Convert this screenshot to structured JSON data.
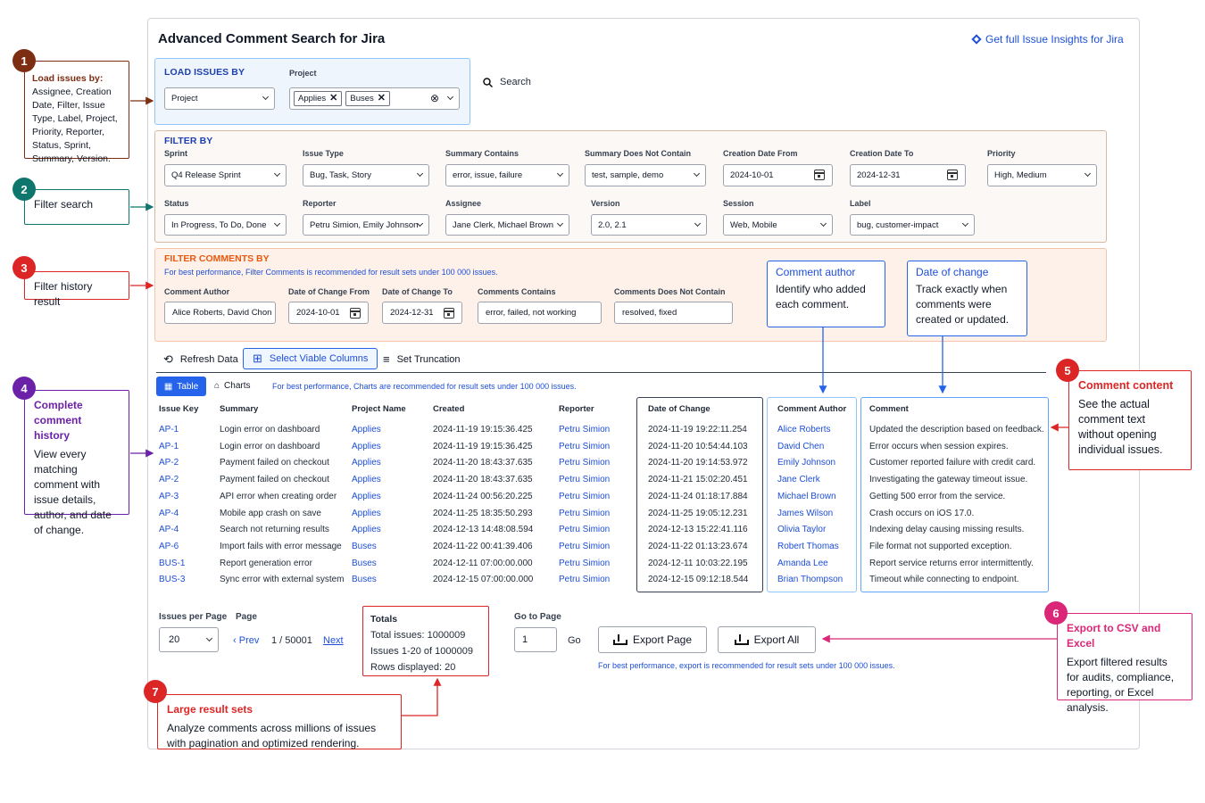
{
  "app": {
    "title": "Advanced Comment Search for Jira",
    "insights_link": "Get full Issue Insights for Jira"
  },
  "load": {
    "title": "LOAD ISSUES BY",
    "project_label": "Project",
    "select_value": "Project",
    "chips": [
      "Applies",
      "Buses"
    ],
    "search_label": "Search"
  },
  "filter": {
    "title": "FILTER BY",
    "fields": [
      {
        "label": "Sprint",
        "value": "Q4 Release Sprint"
      },
      {
        "label": "Issue Type",
        "value": "Bug, Task, Story"
      },
      {
        "label": "Summary Contains",
        "value": "error, issue, failure"
      },
      {
        "label": "Summary Does Not Contain",
        "value": "test, sample, demo"
      },
      {
        "label": "Creation Date From",
        "value": "2024-10-01"
      },
      {
        "label": "Creation Date To",
        "value": "2024-12-31"
      },
      {
        "label": "Priority",
        "value": "High, Medium"
      },
      {
        "label": "Status",
        "value": "In Progress, To Do, Done"
      },
      {
        "label": "Reporter",
        "value": "Petru Simion, Emily Johnson"
      },
      {
        "label": "Assignee",
        "value": "Jane Clerk, Michael Brown"
      },
      {
        "label": "Version",
        "value": "2.0, 2.1"
      },
      {
        "label": "Session",
        "value": "Web, Mobile"
      },
      {
        "label": "Label",
        "value": "bug, customer-impact"
      }
    ]
  },
  "filter_comments": {
    "title": "FILTER COMMENTS BY",
    "note": "For best performance, Filter Comments is recommended for result sets under 100 000 issues.",
    "fields": [
      {
        "label": "Comment Author",
        "value": "Alice Roberts, David Chon"
      },
      {
        "label": "Date of Change From",
        "value": "2024-10-01"
      },
      {
        "label": "Date of Change To",
        "value": "2024-12-31"
      },
      {
        "label": "Comments Contains",
        "value": "error, failed, not working"
      },
      {
        "label": "Comments Does Not Contain",
        "value": "resolved, fixed"
      }
    ]
  },
  "callouts": {
    "author": {
      "title": "Comment author",
      "text": "Identify who added each comment."
    },
    "date": {
      "title": "Date of change",
      "text": "Track exactly when comments were created or updated."
    }
  },
  "toolbar": {
    "refresh": "Refresh Data",
    "columns": "Select Viable Columns",
    "truncation": "Set Truncation",
    "tab_table": "Table",
    "tab_charts": "Charts",
    "charts_note": "For best performance, Charts are recommended for result sets under 100 000 issues."
  },
  "table": {
    "headers": [
      "Issue Key",
      "Summary",
      "Project Name",
      "Created",
      "Reporter",
      "Date of Change",
      "Comment Author",
      "Comment"
    ],
    "rows": [
      [
        "AP-1",
        "Login error on dashboard",
        "Applies",
        "2024-11-19 19:15:36.425",
        "Petru Simion",
        "2024-11-19 19:22:11.254",
        "Alice Roberts",
        "Updated the description based on feedback."
      ],
      [
        "AP-1",
        "Login error on dashboard",
        "Applies",
        "2024-11-19 19:15:36.425",
        "Petru Simion",
        "2024-11-20 10:54:44.103",
        "David Chen",
        "Error occurs when session expires."
      ],
      [
        "AP-2",
        "Payment failed on checkout",
        "Applies",
        "2024-11-20 18:43:37.635",
        "Petru Simion",
        "2024-11-20 19:14:53.972",
        "Emily Johnson",
        "Customer reported failure with credit card."
      ],
      [
        "AP-2",
        "Payment failed on checkout",
        "Applies",
        "2024-11-20 18:43:37.635",
        "Petru Simion",
        "2024-11-21 15:02:20.451",
        "Jane Clerk",
        "Investigating the gateway timeout issue."
      ],
      [
        "AP-3",
        "API error when creating order",
        "Applies",
        "2024-11-24 00:56:20.225",
        "Petru Simion",
        "2024-11-24 01:18:17.884",
        "Michael Brown",
        "Getting 500 error from the service."
      ],
      [
        "AP-4",
        "Mobile app crash on save",
        "Applies",
        "2024-11-25 18:35:50.293",
        "Petru Simion",
        "2024-11-25 19:05:12.231",
        "James Wilson",
        "Crash occurs on iOS 17.0."
      ],
      [
        "AP-4",
        "Search not returning results",
        "Applies",
        "2024-12-13 14:48:08.594",
        "Petru Simion",
        "2024-12-13 15:22:41.116",
        "Olivia Taylor",
        "Indexing delay causing missing results."
      ],
      [
        "AP-6",
        "Import fails with error message",
        "Buses",
        "2024-11-22 00:41:39.406",
        "Petru Simion",
        "2024-11-22 01:13:23.674",
        "Robert Thomas",
        "File format not supported exception."
      ],
      [
        "BUS-1",
        "Report generation error",
        "Buses",
        "2024-12-11 07:00:00.000",
        "Petru Simion",
        "2024-12-11 10:03:22.195",
        "Amanda Lee",
        "Report service returns error intermittently."
      ],
      [
        "BUS-3",
        "Sync error with external system",
        "Buses",
        "2024-12-15 07:00:00.000",
        "Petru Simion",
        "2024-12-15 09:12:18.544",
        "Brian Thompson",
        "Timeout while connecting to endpoint."
      ]
    ]
  },
  "pager": {
    "per_page_label": "Issues per Page",
    "per_page": "20",
    "page_label": "Page",
    "prev": "Prev",
    "page_value": "1 / 50001",
    "next": "Next",
    "totals_title": "Totals",
    "total_issues": "Total issues: 1000009",
    "issues_range": "Issues 1-20 of 1000009",
    "rows_displayed": "Rows displayed: 20",
    "goto_label": "Go to Page",
    "goto_value": "1",
    "go": "Go",
    "export_page": "Export Page",
    "export_all": "Export All",
    "export_note": "For best performance, export is recommended for result sets under 100 000 issues."
  },
  "annotations": [
    {
      "num": "1",
      "color": "#7c2d12",
      "title": "Load issues by:",
      "text": "Assignee, Creation Date, Filter, Issue Type, Label, Project, Priority, Reporter, Status, Sprint, Summary, Version."
    },
    {
      "num": "2",
      "color": "#0f766e",
      "title": "",
      "text": "Filter search"
    },
    {
      "num": "3",
      "color": "#dc2626",
      "title": "",
      "text": "Filter history result"
    },
    {
      "num": "4",
      "color": "#6b21a8",
      "title": "Complete comment history",
      "text": "View every matching comment with issue details, author, and date of change."
    },
    {
      "num": "5",
      "color": "#dc2626",
      "title": "Comment content",
      "text": "See the actual comment text without opening individual issues."
    },
    {
      "num": "6",
      "color": "#db2777",
      "title": "Export to CSV and Excel",
      "text": "Export filtered results for audits, compliance, reporting, or Excel analysis."
    },
    {
      "num": "7",
      "color": "#dc2626",
      "title": "Large result sets",
      "text": "Analyze comments across millions of issues with pagination and optimized rendering."
    }
  ]
}
